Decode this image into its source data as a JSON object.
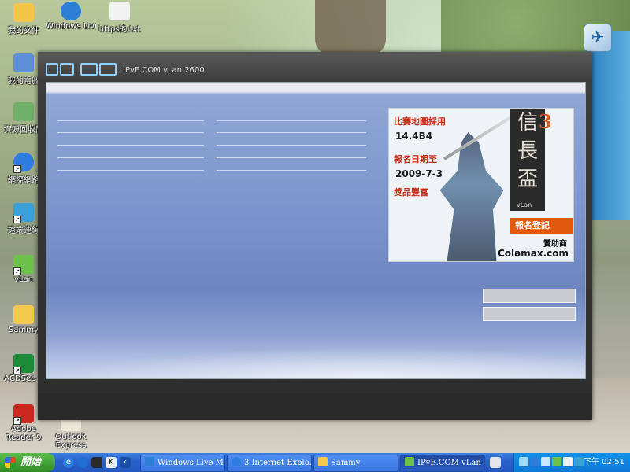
{
  "desktop": {
    "icons": [
      {
        "label": "我的文件",
        "icon": "my-documents-icon",
        "color": "#f3c64b"
      },
      {
        "label": "我的電腦",
        "icon": "my-computer-icon",
        "color": "#5f8fd6"
      },
      {
        "label": "資源回收筒",
        "icon": "recycle-bin-icon",
        "color": "#6fb06a"
      },
      {
        "label": "網際網路",
        "icon": "internet-explorer-icon",
        "color": "#2f7ce0"
      },
      {
        "label": "遠端連線",
        "icon": "remote-connection-icon",
        "color": "#3aa0d8"
      },
      {
        "label": "vLan",
        "icon": "vlan-icon",
        "color": "#6cc24a"
      },
      {
        "label": "Sammy",
        "icon": "folder-icon",
        "color": "#f2c84d"
      },
      {
        "label": "ACDSee 6",
        "icon": "acdsee-icon",
        "color": "#1e8b3a"
      },
      {
        "label": "Adobe Reader 9",
        "icon": "adobe-reader-icon",
        "color": "#c8281e"
      },
      {
        "label": "Outlook Express",
        "icon": "outlook-express-icon",
        "color": "#ece9d8"
      },
      {
        "label": "Windows Live Messenger",
        "icon": "messenger-icon",
        "color": "#2c7fd4"
      },
      {
        "label": "https的.txt",
        "icon": "text-file-icon",
        "color": "#f2f2f2"
      }
    ]
  },
  "app": {
    "title": "IPvE.COM vLan 2600",
    "logo_text": "IPvE"
  },
  "ad": {
    "line1": "比賽地圖採用",
    "line2": "14.4B4",
    "line3": "報名日期至",
    "line4": "2009-7-3",
    "line5": "獎品豐富",
    "title_chars": [
      "信",
      "長",
      "盃"
    ],
    "title_num": "3",
    "vlan_tag": "vLan",
    "register_button": "報名登記",
    "sponsor_label": "贊助商",
    "sponsor_url": "Colamax.com"
  },
  "login": {
    "field1_value": "",
    "field2_value": ""
  },
  "taskbar": {
    "start_label": "開始",
    "quick_launch": [
      "internet-explorer-icon",
      "browser-icon",
      "media-icon",
      "app-icon",
      "switch-icon"
    ],
    "buttons": [
      {
        "label": "Windows Live Me...",
        "icon": "messenger-icon",
        "active": false
      },
      {
        "label": "3 Internet Explo...",
        "icon": "internet-explorer-icon",
        "active": false
      },
      {
        "label": "Sammy",
        "icon": "folder-icon",
        "active": false
      },
      {
        "label": "IPvE.COM vLan ...",
        "icon": "ipve-icon",
        "active": true
      }
    ],
    "clock": "下午 02:51"
  }
}
